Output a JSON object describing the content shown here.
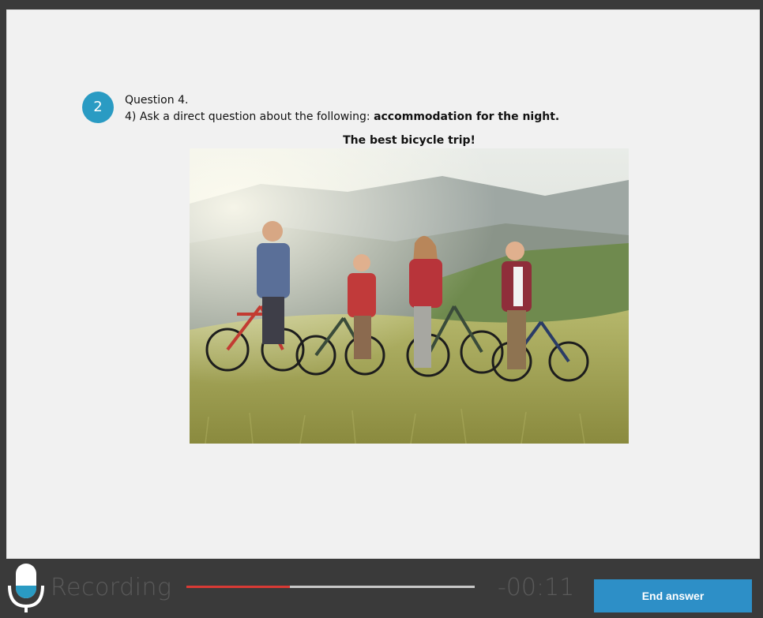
{
  "question": {
    "number_badge": "2",
    "title": "Question 4.",
    "prompt_prefix": "4) Ask a direct question about the following: ",
    "prompt_bold": "accommodation for the night.",
    "image_caption": "The best bicycle trip!"
  },
  "recorder": {
    "status_label": "Recording",
    "timer": "-00:11",
    "progress": 0.36,
    "end_button_label": "End answer"
  },
  "colors": {
    "accent": "#2a9bc3",
    "button": "#2d8fc7",
    "progress_fill": "#d93a35"
  },
  "icons": {
    "microphone": "microphone-icon"
  }
}
